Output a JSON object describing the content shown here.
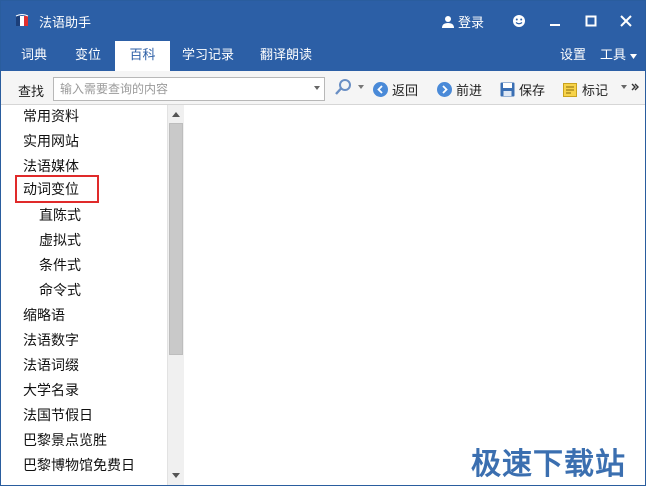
{
  "app": {
    "title": "法语助手"
  },
  "titlebar": {
    "login_label": "登录"
  },
  "tabs": [
    {
      "label": "词典",
      "active": false
    },
    {
      "label": "变位",
      "active": false
    },
    {
      "label": "百科",
      "active": true
    },
    {
      "label": "学习记录",
      "active": false
    },
    {
      "label": "翻译朗读",
      "active": false
    }
  ],
  "menu_right": {
    "settings": "设置",
    "tools": "工具"
  },
  "toolbar": {
    "search_label": "查找",
    "search_placeholder": "输入需要查询的内容",
    "back": "返回",
    "forward": "前进",
    "save": "保存",
    "bookmark": "标记"
  },
  "sidebar": {
    "items": [
      {
        "label": "常用资料",
        "level": 0
      },
      {
        "label": "实用网站",
        "level": 0
      },
      {
        "label": "法语媒体",
        "level": 0
      },
      {
        "label": "动词变位",
        "level": 0,
        "highlighted": true
      },
      {
        "label": "直陈式",
        "level": 1
      },
      {
        "label": "虚拟式",
        "level": 1
      },
      {
        "label": "条件式",
        "level": 1
      },
      {
        "label": "命令式",
        "level": 1
      },
      {
        "label": "缩略语",
        "level": 0
      },
      {
        "label": "法语数字",
        "level": 0
      },
      {
        "label": "法语词缀",
        "level": 0
      },
      {
        "label": "大学名录",
        "level": 0
      },
      {
        "label": "法国节假日",
        "level": 0
      },
      {
        "label": "巴黎景点览胜",
        "level": 0
      },
      {
        "label": "巴黎博物馆免费日",
        "level": 0
      }
    ]
  },
  "watermark": "极速下载站",
  "colors": {
    "brand": "#2c5fa6",
    "highlight": "#e02a2a"
  }
}
